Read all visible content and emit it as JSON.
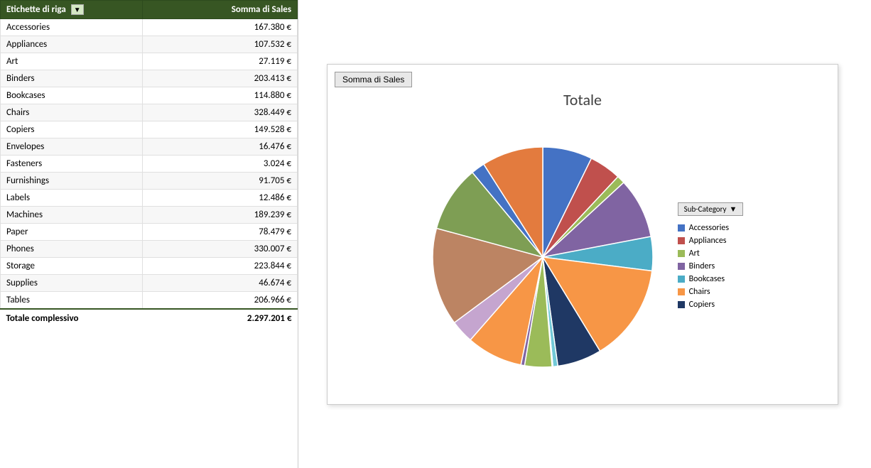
{
  "table": {
    "col1_header": "Etichette di riga",
    "col2_header": "Somma di Sales",
    "filter_symbol": "▼",
    "rows": [
      {
        "label": "Accessories",
        "value": "167.380 €"
      },
      {
        "label": "Appliances",
        "value": "107.532 €"
      },
      {
        "label": "Art",
        "value": "27.119 €"
      },
      {
        "label": "Binders",
        "value": "203.413 €"
      },
      {
        "label": "Bookcases",
        "value": "114.880 €"
      },
      {
        "label": "Chairs",
        "value": "328.449 €"
      },
      {
        "label": "Copiers",
        "value": "149.528 €"
      },
      {
        "label": "Envelopes",
        "value": "16.476 €"
      },
      {
        "label": "Fasteners",
        "value": "3.024 €"
      },
      {
        "label": "Furnishings",
        "value": "91.705 €"
      },
      {
        "label": "Labels",
        "value": "12.486 €"
      },
      {
        "label": "Machines",
        "value": "189.239 €"
      },
      {
        "label": "Paper",
        "value": "78.479 €"
      },
      {
        "label": "Phones",
        "value": "330.007 €"
      },
      {
        "label": "Storage",
        "value": "223.844 €"
      },
      {
        "label": "Supplies",
        "value": "46.674 €"
      },
      {
        "label": "Tables",
        "value": "206.966 €"
      }
    ],
    "total_label": "Totale complessivo",
    "total_value": "2.297.201 €"
  },
  "chart": {
    "button_label": "Somma di Sales",
    "title": "Totale",
    "filter_button_label": "Sub-Category",
    "legend": [
      {
        "label": "Accessories",
        "color": "#4472C4"
      },
      {
        "label": "Appliances",
        "color": "#C0504D"
      },
      {
        "label": "Art",
        "color": "#9BBB59"
      },
      {
        "label": "Binders",
        "color": "#8064A2"
      },
      {
        "label": "Bookcases",
        "color": "#4BACC6"
      },
      {
        "label": "Chairs",
        "color": "#F79646"
      },
      {
        "label": "Copiers",
        "color": "#1F3864"
      }
    ],
    "slices": [
      {
        "label": "Accessories",
        "color": "#4472C4",
        "value": 167380,
        "percent": 7.29
      },
      {
        "label": "Appliances",
        "color": "#C0504D",
        "value": 107532,
        "percent": 4.68
      },
      {
        "label": "Art",
        "color": "#9BBB59",
        "value": 27119,
        "percent": 1.18
      },
      {
        "label": "Binders",
        "color": "#8064A2",
        "value": 203413,
        "percent": 8.85
      },
      {
        "label": "Bookcases",
        "color": "#4BACC6",
        "value": 114880,
        "percent": 5.0
      },
      {
        "label": "Chairs",
        "color": "#F79646",
        "value": 328449,
        "percent": 14.3
      },
      {
        "label": "Copiers",
        "color": "#1F3864",
        "value": 149528,
        "percent": 6.51
      },
      {
        "label": "Envelopes",
        "color": "#72C9D8",
        "value": 16476,
        "percent": 0.72
      },
      {
        "label": "Fasteners",
        "color": "#C0504D",
        "value": 3024,
        "percent": 0.13
      },
      {
        "label": "Furnishings",
        "color": "#9BBB59",
        "value": 91705,
        "percent": 3.99
      },
      {
        "label": "Labels",
        "color": "#8064A2",
        "value": 12486,
        "percent": 0.54
      },
      {
        "label": "Machines",
        "color": "#F79646",
        "value": 189239,
        "percent": 8.24
      },
      {
        "label": "Paper",
        "color": "#C5A5CF",
        "value": 78479,
        "percent": 3.42
      },
      {
        "label": "Phones",
        "color": "#BC8463",
        "value": 330007,
        "percent": 14.37
      },
      {
        "label": "Storage",
        "color": "#7E9E54",
        "value": 223844,
        "percent": 9.75
      },
      {
        "label": "Supplies",
        "color": "#4472C4",
        "value": 46674,
        "percent": 2.03
      },
      {
        "label": "Tables",
        "color": "#E37B3E",
        "value": 206966,
        "percent": 9.01
      }
    ]
  }
}
